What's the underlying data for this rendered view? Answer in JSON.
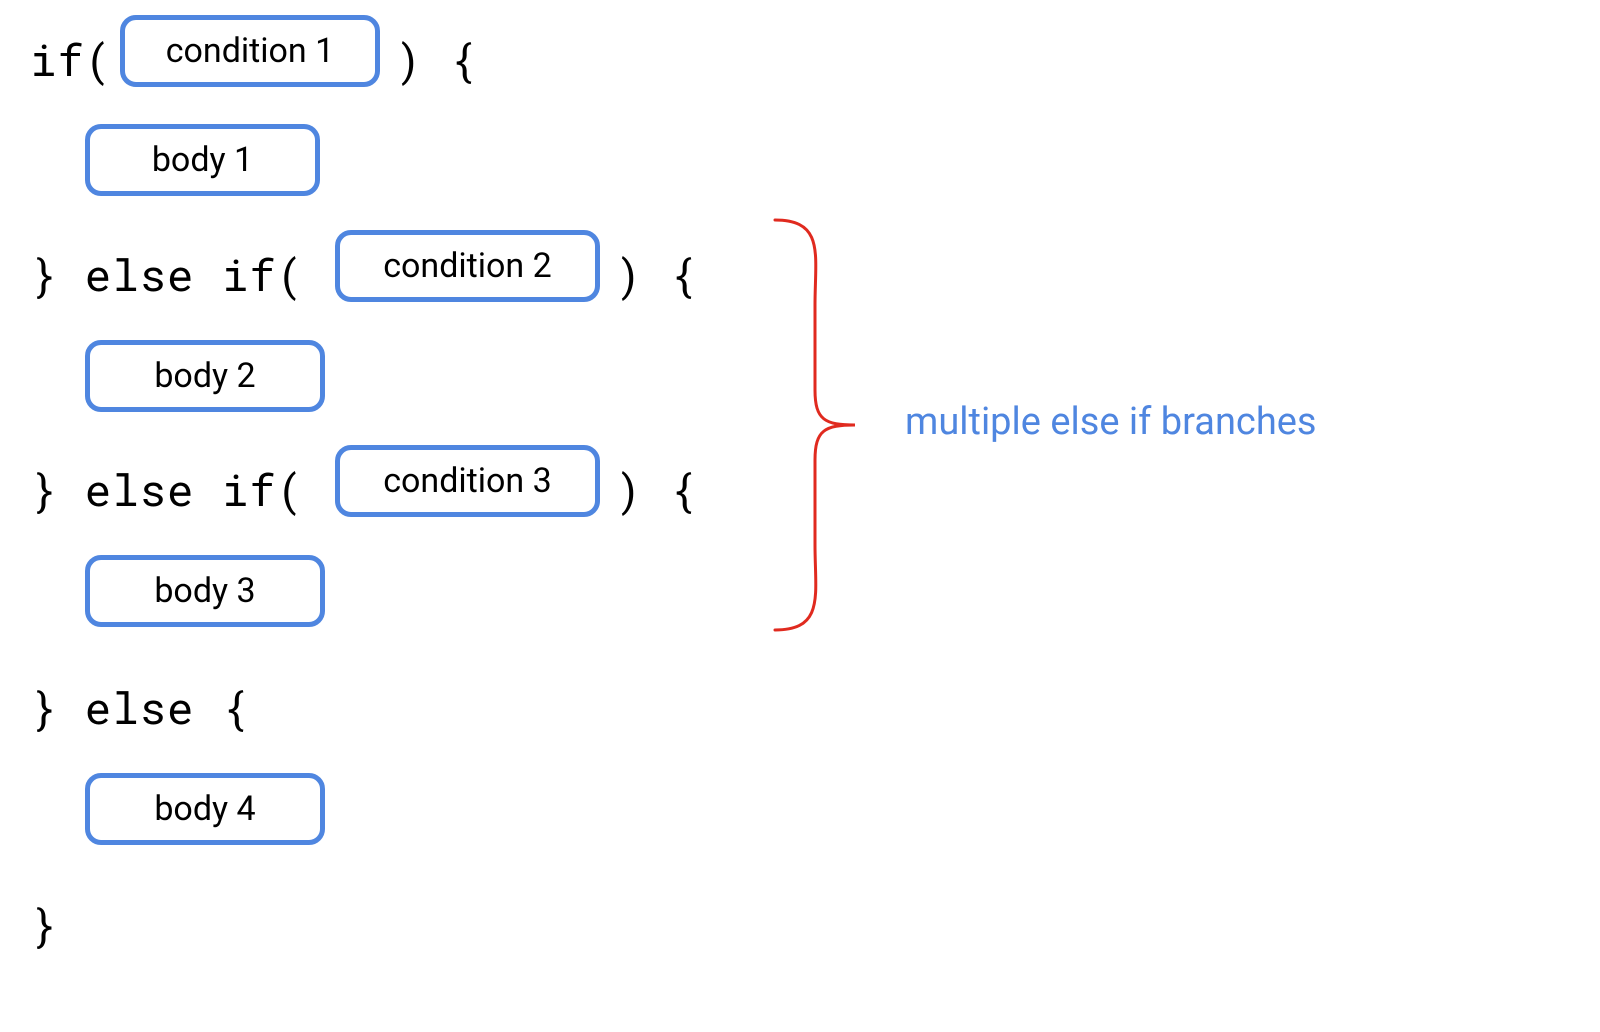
{
  "code": {
    "if_open": "if(",
    "if_close": ") {",
    "else_if_open": "} else if(",
    "else_open": "} else {",
    "close": "}"
  },
  "pills": {
    "condition1": "condition 1",
    "condition2": "condition 2",
    "condition3": "condition 3",
    "body1": "body 1",
    "body2": "body 2",
    "body3": "body 3",
    "body4": "body 4"
  },
  "annotation": {
    "text": "multiple else if branches",
    "color": "#4f86e0",
    "brace_color": "#e02a1f"
  }
}
